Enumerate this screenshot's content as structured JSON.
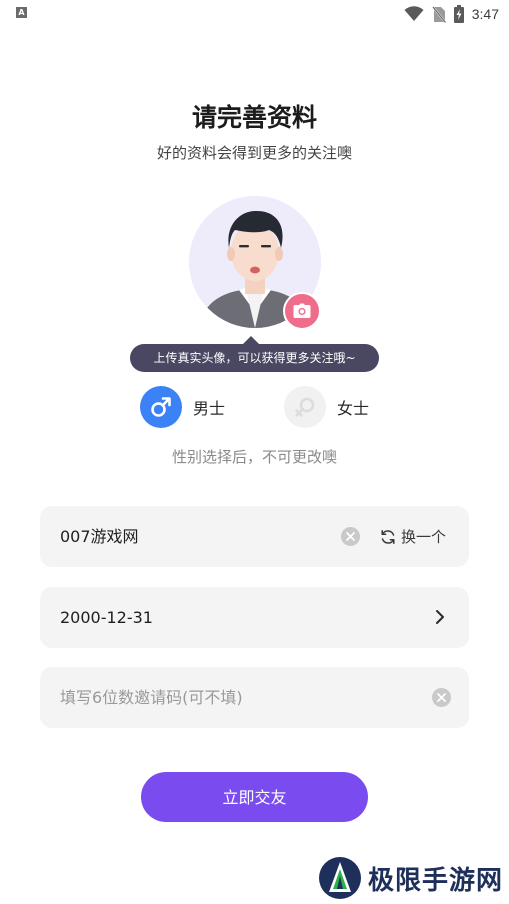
{
  "status_bar": {
    "notification_icon": "A",
    "time": "3:47",
    "icons": [
      "wifi-icon",
      "no-sim-icon",
      "battery-charging-icon"
    ]
  },
  "header": {
    "title": "请完善资料",
    "subtitle": "好的资料会得到更多的关注噢"
  },
  "avatar": {
    "tooltip": "上传真实头像，可以获得更多关注哦~",
    "camera_icon": "camera-icon"
  },
  "gender": {
    "male_label": "男士",
    "female_label": "女士",
    "selected": "male",
    "note": "性别选择后，不可更改噢",
    "colors": {
      "male_active": "#3b82f6",
      "inactive": "#f1f1f1"
    }
  },
  "form": {
    "nickname": {
      "value": "007游戏网",
      "refresh_label": "换一个"
    },
    "birthday": {
      "value": "2000-12-31"
    },
    "invite_code": {
      "value": "",
      "placeholder": "填写6位数邀请码(可不填)"
    }
  },
  "submit_label": "立即交友",
  "watermark": {
    "text": "极限手游网"
  },
  "colors": {
    "accent": "#7a4cf0",
    "tooltip_bg": "#4a4763",
    "camera_badge": "#f06c8b"
  }
}
